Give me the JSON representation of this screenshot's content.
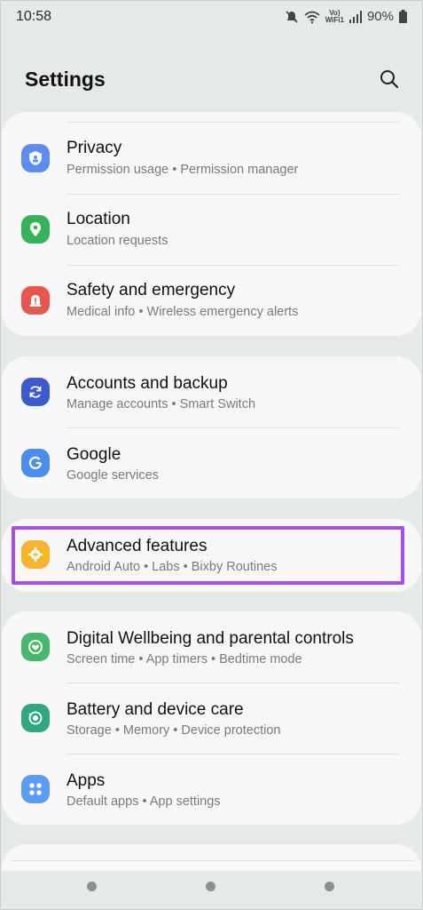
{
  "status_bar": {
    "time": "10:58",
    "battery": "90%",
    "network_label_top": "Vo)",
    "network_label_bottom": "WiFi1"
  },
  "header": {
    "title": "Settings"
  },
  "colors": {
    "privacy": "#5b8def",
    "location": "#34b35a",
    "safety": "#e8574e",
    "accounts": "#3d5bd0",
    "google": "#4a8cef",
    "advanced": "#f7b32b",
    "wellbeing": "#49b86a",
    "battery": "#2ea77f",
    "apps": "#5b9cf2",
    "highlight": "#a64ee6"
  },
  "items": [
    {
      "title": "Privacy",
      "subtitle": "Permission usage  •  Permission manager",
      "icon": "shield-icon"
    },
    {
      "title": "Location",
      "subtitle": "Location requests",
      "icon": "location-pin-icon"
    },
    {
      "title": "Safety and emergency",
      "subtitle": "Medical info  •  Wireless emergency alerts",
      "icon": "emergency-alert-icon"
    },
    {
      "title": "Accounts and backup",
      "subtitle": "Manage accounts  •  Smart Switch",
      "icon": "sync-icon"
    },
    {
      "title": "Google",
      "subtitle": "Google services",
      "icon": "google-icon"
    },
    {
      "title": "Advanced features",
      "subtitle": "Android Auto  •  Labs  •  Bixby Routines",
      "icon": "gear-plus-icon"
    },
    {
      "title": "Digital Wellbeing and parental controls",
      "subtitle": "Screen time  •  App timers  •  Bedtime mode",
      "icon": "heart-circle-icon"
    },
    {
      "title": "Battery and device care",
      "subtitle": "Storage  •  Memory  •  Device protection",
      "icon": "device-care-icon"
    },
    {
      "title": "Apps",
      "subtitle": "Default apps  •  App settings",
      "icon": "apps-grid-icon"
    }
  ]
}
